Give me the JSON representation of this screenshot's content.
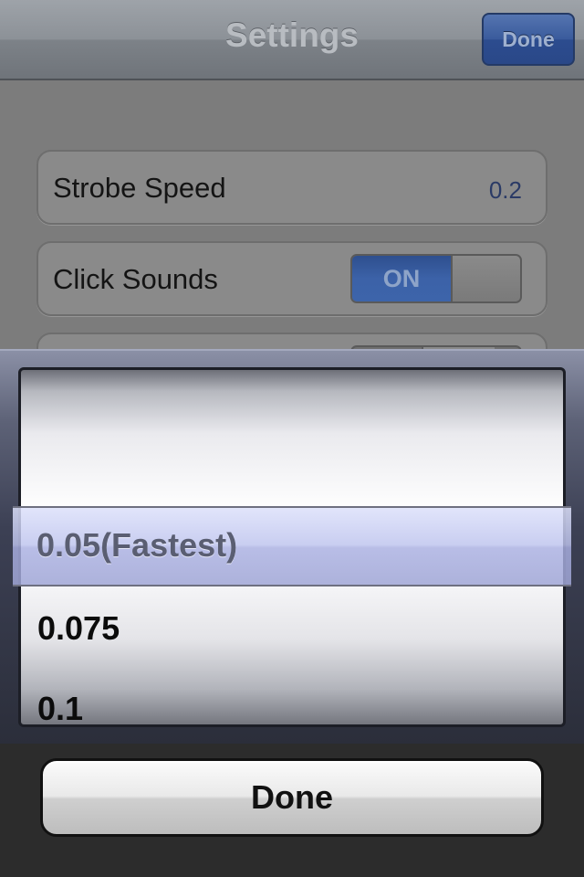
{
  "navbar": {
    "title": "Settings",
    "done_label": "Done"
  },
  "settings": {
    "strobe_speed": {
      "label": "Strobe Speed",
      "value": "0.2"
    },
    "click_sounds": {
      "label": "Click Sounds",
      "switch_label": "ON",
      "state": "on"
    }
  },
  "picker": {
    "selected_option": "0.05(Fastest)",
    "options_below": [
      "0.075",
      "0.1"
    ]
  },
  "done_button": {
    "label": "Done"
  },
  "colors": {
    "accent_blue": "#3c62a8",
    "picker_selection": "#bec4ee"
  }
}
